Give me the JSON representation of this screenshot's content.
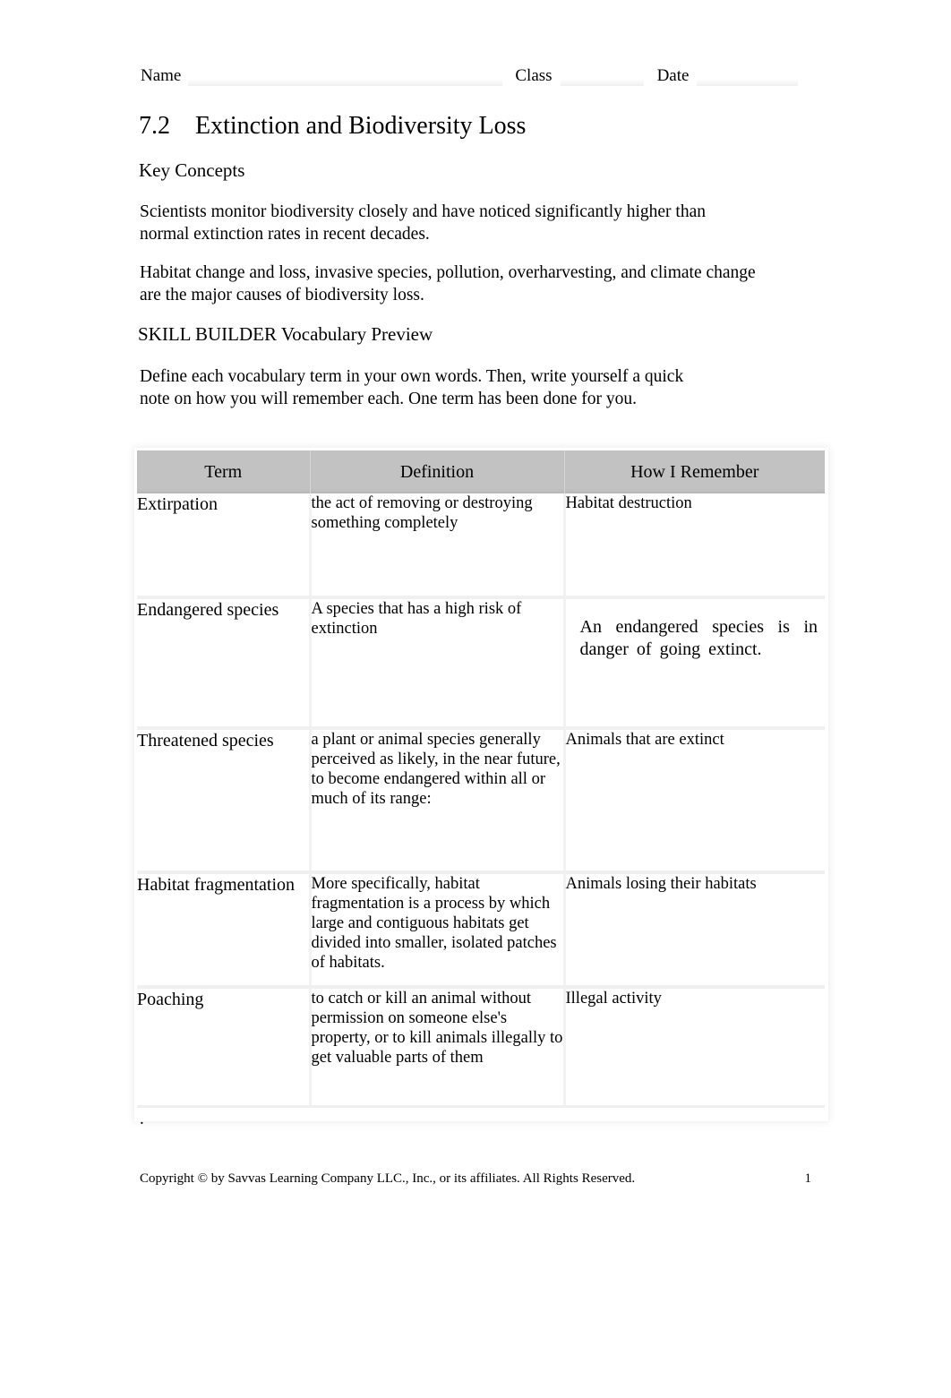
{
  "header": {
    "name_label": "Name",
    "class_label": "Class",
    "date_label": "Date",
    "name_value": "",
    "class_value": "",
    "date_value": ""
  },
  "title": {
    "number": "7.2",
    "text": "Extinction and Biodiversity Loss",
    "full": "7.2    Extinction and Biodiversity Loss"
  },
  "sections": {
    "key_concepts_heading": "Key Concepts",
    "key_concept_1": "Scientists monitor biodiversity closely and have noticed significantly higher than normal extinction rates in recent decades.",
    "key_concept_2": "Habitat change and loss, invasive species, pollution, overharvesting, and climate change are the major causes of biodiversity loss.",
    "skill_builder_heading": "SKILL BUILDER Vocabulary Preview",
    "instructions": "Define each vocabulary term in your own words. Then, write yourself a quick note on how you will remember each. One term has been done for you."
  },
  "table": {
    "columns": [
      "Term",
      "Definition",
      "How I Remember"
    ],
    "rows": [
      {
        "term": "Extirpation",
        "definition": "the act of removing or destroying something completely",
        "remember": "Habitat destruction"
      },
      {
        "term": "Endangered species",
        "definition": "A species that has a high risk of extinction",
        "remember": "An endangered species is in danger of going extinct."
      },
      {
        "term": "Threatened species",
        "definition": "a plant or animal species generally perceived as likely, in the near future, to become endangered within all or much of its range:",
        "remember": "Animals that are extinct"
      },
      {
        "term": "Habitat fragmentation",
        "definition": "More specifically, habitat fragmentation is a process by which large and contiguous habitats get divided into smaller, isolated patches of habitats.",
        "remember": "Animals losing their habitats"
      },
      {
        "term": "Poaching",
        "definition": "to catch or kill an animal without permission on someone else's property, or to kill animals illegally to get valuable parts of them",
        "remember": "Illegal activity"
      }
    ]
  },
  "stray_mark": ".",
  "footer": {
    "copyright": "Copyright © by Savvas Learning Company LLC., Inc., or its affiliates. All Rights Reserved.",
    "page_number": "1"
  },
  "colors": {
    "header_row_background": "#c2c2c2",
    "text": "#000000",
    "page_background": "#ffffff"
  }
}
